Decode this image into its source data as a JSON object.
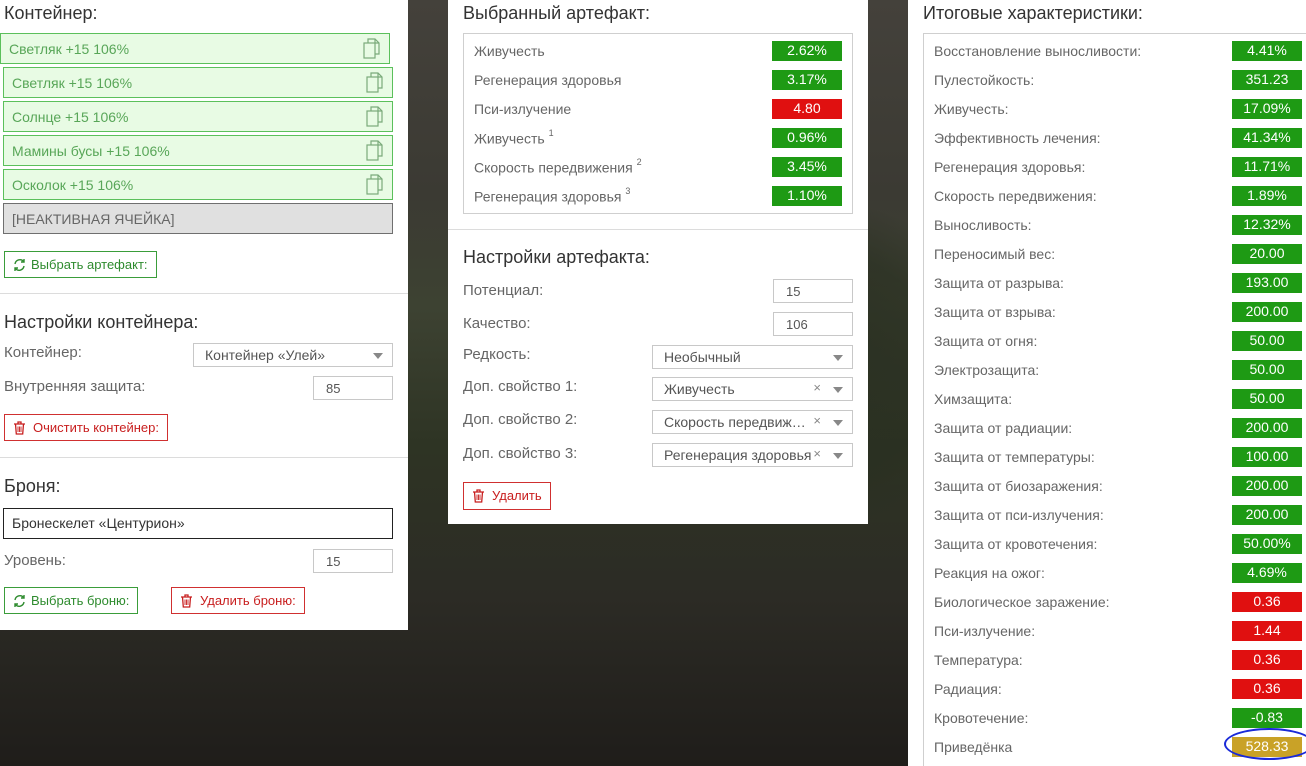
{
  "container": {
    "title": "Контейнер:",
    "slots": [
      "Светляк +15 106%",
      "Светляк +15 106%",
      "Солнце +15 106%",
      "Мамины бусы +15 106%",
      "Осколок +15 106%"
    ],
    "inactive_slot": "[НЕАКТИВНАЯ ЯЧЕЙКА]",
    "select_artifact_button": "Выбрать артефакт:"
  },
  "container_settings": {
    "title": "Настройки контейнера:",
    "container_label": "Контейнер:",
    "container_value": "Контейнер «Улей»",
    "internal_protection_label": "Внутренняя защита:",
    "internal_protection_value": "85",
    "clear_button": "Очистить контейнер:"
  },
  "armor": {
    "title": "Броня:",
    "name": "Бронескелет «Центурион»",
    "level_label": "Уровень:",
    "level_value": "15",
    "select_button": "Выбрать броню:",
    "delete_button": "Удалить броню:"
  },
  "selected_artifact": {
    "title": "Выбранный артефакт:",
    "stats": [
      {
        "name": "Живучесть",
        "sup": "",
        "value": "2.62%",
        "kind": "pos"
      },
      {
        "name": "Регенерация здоровья",
        "sup": "",
        "value": "3.17%",
        "kind": "pos"
      },
      {
        "name": "Пси-излучение",
        "sup": "",
        "value": "4.80",
        "kind": "neg"
      },
      {
        "name": "Живучесть",
        "sup": "1",
        "value": "0.96%",
        "kind": "pos"
      },
      {
        "name": "Скорость передвижения",
        "sup": "2",
        "value": "3.45%",
        "kind": "pos"
      },
      {
        "name": "Регенерация здоровья",
        "sup": "3",
        "value": "1.10%",
        "kind": "pos"
      }
    ]
  },
  "artifact_settings": {
    "title": "Настройки артефакта:",
    "potential_label": "Потенциал:",
    "potential_value": "15",
    "quality_label": "Качество:",
    "quality_value": "106",
    "rarity_label": "Редкость:",
    "rarity_value": "Необычный",
    "prop1_label": "Доп. свойство 1:",
    "prop1_value": "Живучесть",
    "prop2_label": "Доп. свойство 2:",
    "prop2_value": "Скорость передвижения",
    "prop3_label": "Доп. свойство 3:",
    "prop3_value": "Регенерация здоровья",
    "clear_glyph": "×",
    "delete_button": "Удалить"
  },
  "totals": {
    "title": "Итоговые характеристики:",
    "stats": [
      {
        "name": "Восстановление выносливости:",
        "value": "4.41%",
        "kind": "pos"
      },
      {
        "name": "Пулестойкость:",
        "value": "351.23",
        "kind": "pos"
      },
      {
        "name": "Живучесть:",
        "value": "17.09%",
        "kind": "pos"
      },
      {
        "name": "Эффективность лечения:",
        "value": "41.34%",
        "kind": "pos"
      },
      {
        "name": "Регенерация здоровья:",
        "value": "11.71%",
        "kind": "pos"
      },
      {
        "name": "Скорость передвижения:",
        "value": "1.89%",
        "kind": "pos"
      },
      {
        "name": "Выносливость:",
        "value": "12.32%",
        "kind": "pos"
      },
      {
        "name": "Переносимый вес:",
        "value": "20.00",
        "kind": "pos"
      },
      {
        "name": "Защита от разрыва:",
        "value": "193.00",
        "kind": "pos"
      },
      {
        "name": "Защита от взрыва:",
        "value": "200.00",
        "kind": "pos"
      },
      {
        "name": "Защита от огня:",
        "value": "50.00",
        "kind": "pos"
      },
      {
        "name": "Электрозащита:",
        "value": "50.00",
        "kind": "pos"
      },
      {
        "name": "Химзащита:",
        "value": "50.00",
        "kind": "pos"
      },
      {
        "name": "Защита от радиации:",
        "value": "200.00",
        "kind": "pos"
      },
      {
        "name": "Защита от температуры:",
        "value": "100.00",
        "kind": "pos"
      },
      {
        "name": "Защита от биозаражения:",
        "value": "200.00",
        "kind": "pos"
      },
      {
        "name": "Защита от пси-излучения:",
        "value": "200.00",
        "kind": "pos"
      },
      {
        "name": "Защита от кровотечения:",
        "value": "50.00%",
        "kind": "pos"
      },
      {
        "name": "Реакция на ожог:",
        "value": "4.69%",
        "kind": "pos"
      },
      {
        "name": "Биологическое заражение:",
        "value": "0.36",
        "kind": "neg"
      },
      {
        "name": "Пси-излучение:",
        "value": "1.44",
        "kind": "neg"
      },
      {
        "name": "Температура:",
        "value": "0.36",
        "kind": "neg"
      },
      {
        "name": "Радиация:",
        "value": "0.36",
        "kind": "neg"
      },
      {
        "name": "Кровотечение:",
        "value": "-0.83",
        "kind": "pos"
      },
      {
        "name": "Приведёнка",
        "value": "528.33",
        "kind": "gold"
      }
    ]
  },
  "colors": {
    "positive": "#1e9a14",
    "negative": "#e01010",
    "highlight": "#c9a227",
    "annotation": "#1a2ad8"
  },
  "icons": {
    "copy": "copy-icon",
    "refresh": "refresh-icon",
    "trash": "trash-icon",
    "chevron": "chevron-down-icon"
  }
}
